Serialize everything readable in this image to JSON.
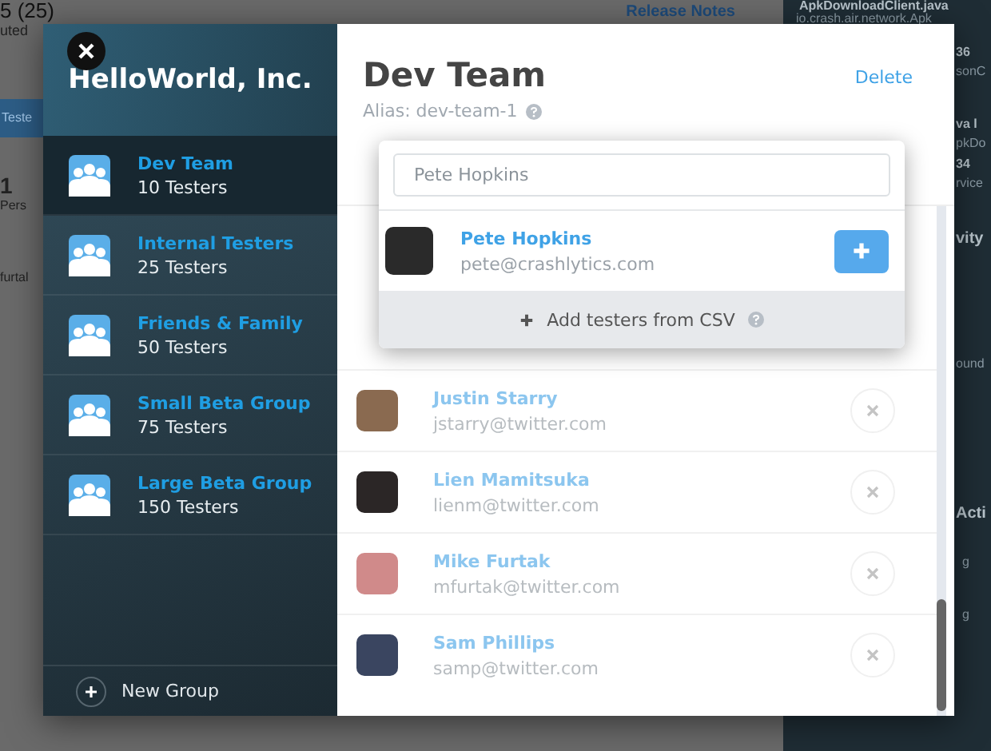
{
  "background": {
    "count": "5 (25)",
    "count_sub": "uted",
    "release_notes": "Release Notes",
    "tab": "Teste",
    "left_lines": [
      {
        "text": "1",
        "kind": "big"
      },
      {
        "text": "Pers",
        "kind": "small"
      },
      {
        "text": "furtal",
        "kind": "plain"
      }
    ],
    "side_lines": [
      {
        "text": "ApkDownloadClient.java",
        "kind": "bold"
      },
      {
        "text": "io.crash.air.network.Apk",
        "kind": "plain"
      },
      {
        "text": "36",
        "kind": "bold"
      },
      {
        "text": "sonC",
        "kind": "plain"
      },
      {
        "text": "va l",
        "kind": "bold"
      },
      {
        "text": "pkDo",
        "kind": "plain"
      },
      {
        "text": "34",
        "kind": "bold"
      },
      {
        "text": "rvice",
        "kind": "plain"
      },
      {
        "text": "vity",
        "kind": "heading"
      },
      {
        "text": "ound",
        "kind": "plain"
      },
      {
        "text": "Acti",
        "kind": "heading"
      },
      {
        "text": "g",
        "kind": "plain"
      },
      {
        "text": "g",
        "kind": "plain"
      }
    ]
  },
  "sidebar": {
    "company": "HelloWorld, Inc.",
    "groups": [
      {
        "name": "Dev Team",
        "count": "10 Testers",
        "selected": true
      },
      {
        "name": "Internal Testers",
        "count": "25 Testers",
        "selected": false
      },
      {
        "name": "Friends & Family",
        "count": "50 Testers",
        "selected": false
      },
      {
        "name": "Small Beta Group",
        "count": "75 Testers",
        "selected": false
      },
      {
        "name": "Large Beta Group",
        "count": "150 Testers",
        "selected": false
      }
    ],
    "new_group": "New Group"
  },
  "detail": {
    "title": "Dev Team",
    "delete": "Delete",
    "alias": "Alias: dev-team-1",
    "testers": [
      {
        "name": "Justin Starry",
        "email": "jstarry@twitter.com"
      },
      {
        "name": "Lien Mamitsuka",
        "email": "lienm@twitter.com"
      },
      {
        "name": "Mike Furtak",
        "email": "mfurtak@twitter.com"
      },
      {
        "name": "Sam Phillips",
        "email": "samp@twitter.com"
      }
    ],
    "add_popup": {
      "search_value": "Pete Hopkins",
      "result": {
        "name": "Pete Hopkins",
        "email": "pete@crashlytics.com"
      },
      "csv": "Add testers from CSV"
    }
  }
}
